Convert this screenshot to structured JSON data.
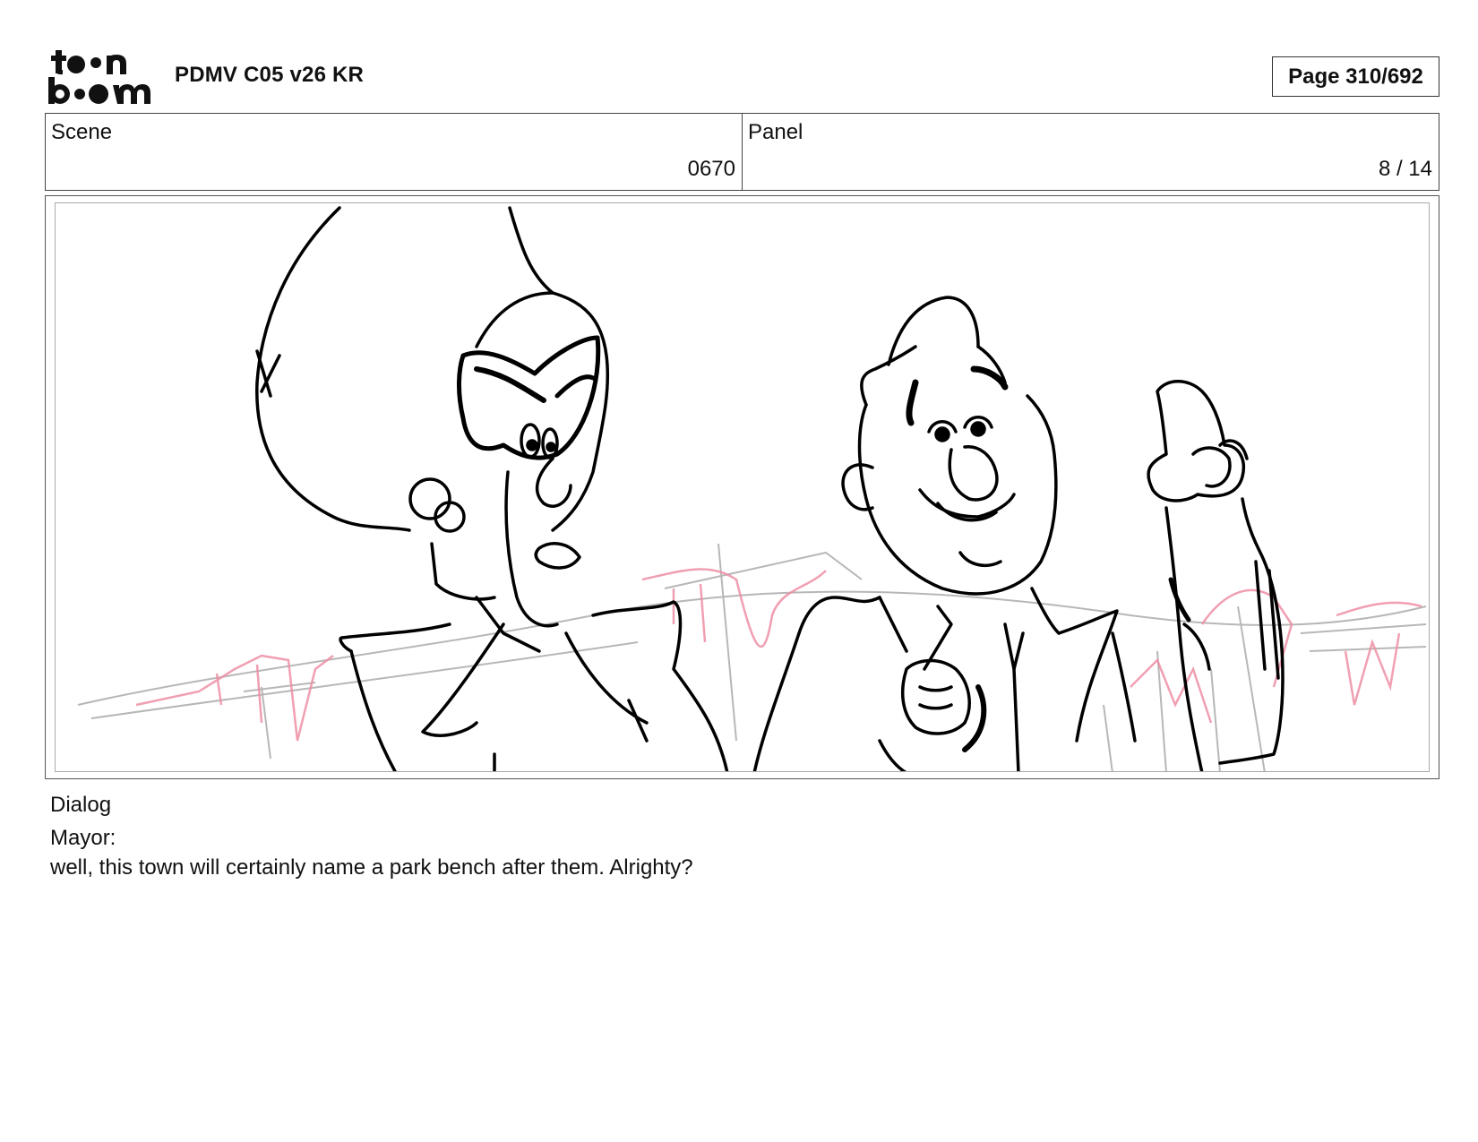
{
  "header": {
    "logo_alt": "toon boom",
    "logo_icon": "toonboom-logo",
    "title": "PDMV C05 v26 KR",
    "page": "Page 310/692"
  },
  "info": {
    "scene_label": "Scene",
    "scene_value": "0670",
    "panel_label": "Panel",
    "panel_value": "8 / 14"
  },
  "panel_image": {
    "description_icon": "storyboard-sketch",
    "line_color": "#000000",
    "accent_color": "#ee8fa4",
    "guide_color": "#9a9a9a"
  },
  "dialog": {
    "label": "Dialog",
    "speaker": "Mayor:",
    "line": "well, this town will certainly name a park bench after them. Alrighty?"
  }
}
